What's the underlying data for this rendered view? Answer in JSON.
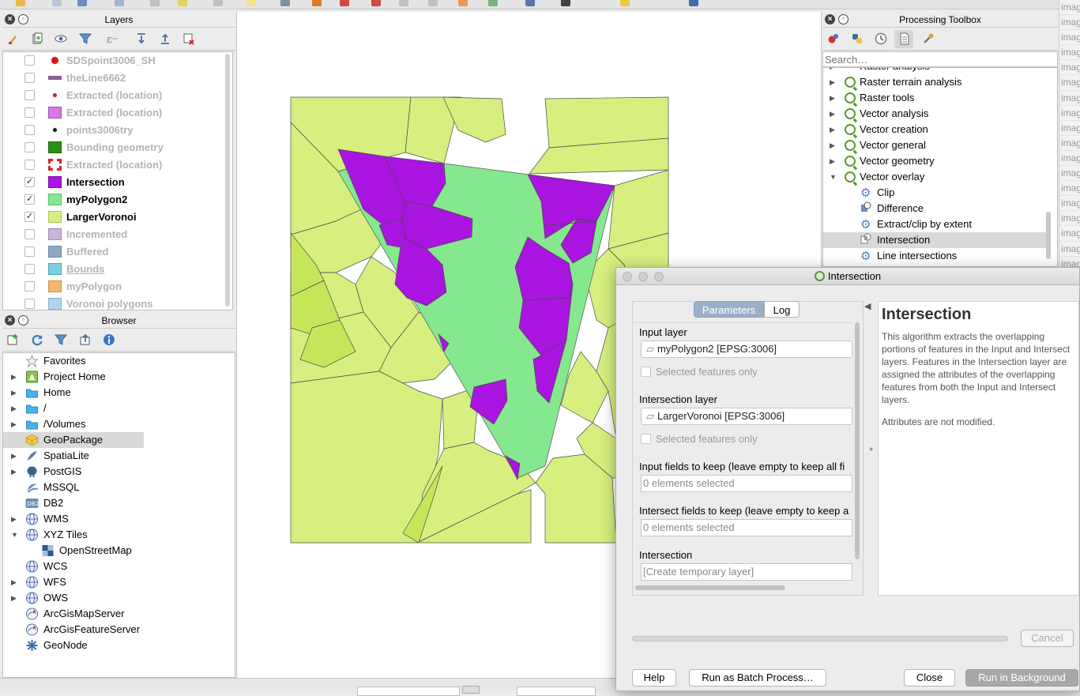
{
  "layers_panel": {
    "title": "Layers",
    "layers": [
      {
        "name": "SDSpoint3006_SH",
        "checked": false,
        "symbol": "red-dot"
      },
      {
        "name": "theLine6662",
        "checked": false,
        "symbol": "purple-line"
      },
      {
        "name": "Extracted (location)",
        "checked": false,
        "symbol": "small-red-dot"
      },
      {
        "name": "Extracted (location)",
        "checked": false,
        "symbol": "pink-fill"
      },
      {
        "name": "points3006try",
        "checked": false,
        "symbol": "black-dot"
      },
      {
        "name": "Bounding geometry",
        "checked": false,
        "symbol": "green-fill"
      },
      {
        "name": "Extracted (location)",
        "checked": false,
        "symbol": "red-outline"
      },
      {
        "name": "Intersection",
        "checked": true,
        "symbol": "purple-fill"
      },
      {
        "name": "myPolygon2",
        "checked": true,
        "symbol": "lightgreen-fill"
      },
      {
        "name": "LargerVoronoi",
        "checked": true,
        "symbol": "yellowgreen-fill"
      },
      {
        "name": "Incremented",
        "checked": false,
        "symbol": "lavender-fill"
      },
      {
        "name": "Buffered",
        "checked": false,
        "symbol": "steel-fill"
      },
      {
        "name": "Bounds",
        "checked": false,
        "symbol": "cyan-fill"
      },
      {
        "name": "myPolygon",
        "checked": false,
        "symbol": "orange-fill"
      },
      {
        "name": "Voronoi polygons",
        "checked": false,
        "symbol": "lightblue-fill"
      }
    ],
    "check_mark": "✓"
  },
  "browser_panel": {
    "title": "Browser",
    "items": [
      {
        "name": "Favorites",
        "expandable": false,
        "icon": "star-icon"
      },
      {
        "name": "Project Home",
        "expandable": true,
        "icon": "project-icon"
      },
      {
        "name": "Home",
        "expandable": true,
        "icon": "folder-icon"
      },
      {
        "name": "/",
        "expandable": true,
        "icon": "folder-icon"
      },
      {
        "name": "/Volumes",
        "expandable": true,
        "icon": "folder-icon"
      },
      {
        "name": "GeoPackage",
        "expandable": false,
        "icon": "geopackage-icon",
        "selected": true
      },
      {
        "name": "SpatiaLite",
        "expandable": true,
        "icon": "feather-icon"
      },
      {
        "name": "PostGIS",
        "expandable": true,
        "icon": "elephant-icon"
      },
      {
        "name": "MSSQL",
        "expandable": false,
        "icon": "mssql-icon"
      },
      {
        "name": "DB2",
        "expandable": false,
        "icon": "db2-icon"
      },
      {
        "name": "WMS",
        "expandable": true,
        "icon": "globe-icon"
      },
      {
        "name": "XYZ Tiles",
        "expandable": true,
        "expanded": true,
        "icon": "globe-icon"
      },
      {
        "name": "OpenStreetMap",
        "expandable": false,
        "icon": "tiles-icon",
        "child": true
      },
      {
        "name": "WCS",
        "expandable": false,
        "icon": "globe-icon"
      },
      {
        "name": "WFS",
        "expandable": true,
        "icon": "globe-icon"
      },
      {
        "name": "OWS",
        "expandable": true,
        "icon": "globe-icon"
      },
      {
        "name": "ArcGisMapServer",
        "expandable": false,
        "icon": "arcgis-icon"
      },
      {
        "name": "ArcGisFeatureServer",
        "expandable": false,
        "icon": "arcgis-icon"
      },
      {
        "name": "GeoNode",
        "expandable": false,
        "icon": "geonode-icon"
      }
    ]
  },
  "toolbox": {
    "title": "Processing Toolbox",
    "search_placeholder": "Search…",
    "cut_label": "Raster analysis",
    "groups": [
      {
        "name": "Raster terrain analysis",
        "expanded": false
      },
      {
        "name": "Raster tools",
        "expanded": false
      },
      {
        "name": "Vector analysis",
        "expanded": false
      },
      {
        "name": "Vector creation",
        "expanded": false
      },
      {
        "name": "Vector general",
        "expanded": false
      },
      {
        "name": "Vector geometry",
        "expanded": false
      },
      {
        "name": "Vector overlay",
        "expanded": true
      }
    ],
    "algorithms": [
      {
        "name": "Clip",
        "icon": "gear-icon"
      },
      {
        "name": "Difference",
        "icon": "difference-icon"
      },
      {
        "name": "Extract/clip by extent",
        "icon": "gear-icon"
      },
      {
        "name": "Intersection",
        "icon": "intersection-icon",
        "selected": true
      },
      {
        "name": "Line intersections",
        "icon": "gear-icon"
      }
    ]
  },
  "right_strip": {
    "items": [
      "imag",
      "imag",
      "imag",
      "imag",
      "imag",
      "imag",
      "imag",
      "imag",
      "imag",
      "imag",
      "imag",
      "imag",
      "imag",
      "imag",
      "imag",
      "imag",
      "imag",
      "imag"
    ]
  },
  "dialog": {
    "title": "Intersection",
    "tabs": {
      "parameters": "Parameters",
      "log": "Log"
    },
    "input_layer_label": "Input layer",
    "input_layer_value": "myPolygon2 [EPSG:3006]",
    "selected_only_1": "Selected features only",
    "intersection_layer_label": "Intersection layer",
    "intersection_layer_value": "LargerVoronoi [EPSG:3006]",
    "selected_only_2": "Selected features only",
    "input_fields_label": "Input fields to keep (leave empty to keep all fi",
    "input_fields_value": "0 elements selected",
    "intersect_fields_label": "Intersect fields to keep (leave empty to keep a",
    "intersect_fields_value": "0 elements selected",
    "output_label": "Intersection",
    "output_placeholder": "[Create temporary layer]",
    "help_title": "Intersection",
    "help_p1": "This algorithm extracts the overlapping portions of features in the Input and Intersect layers. Features in the Intersection layer are assigned the attributes of the overlapping features from both the Input and Intersect layers.",
    "help_p2": "Attributes are not modified.",
    "buttons": {
      "cancel": "Cancel",
      "help": "Help",
      "batch": "Run as Batch Process…",
      "close": "Close",
      "run_bg": "Run in Background"
    },
    "collapse_arrow": "◀"
  },
  "colors": {
    "voronoi_fill": "#d6ef7e",
    "polygon_fill": "#85e88e",
    "intersection_fill": "#a914e0",
    "accent_selected": "#d9d9d9"
  }
}
